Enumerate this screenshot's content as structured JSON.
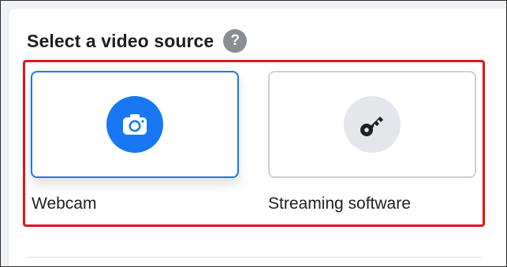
{
  "section": {
    "title": "Select a video source",
    "help_glyph": "?"
  },
  "options": [
    {
      "id": "webcam",
      "label": "Webcam",
      "icon": "camera-icon",
      "selected": true
    },
    {
      "id": "streaming",
      "label": "Streaming software",
      "icon": "key-icon",
      "selected": false
    }
  ],
  "colors": {
    "accent": "#1877f2",
    "highlight": "#e0141e",
    "icon_bg_unselected": "#e4e6eb",
    "text": "#1c1e21",
    "help_bg": "#8a8d91"
  }
}
